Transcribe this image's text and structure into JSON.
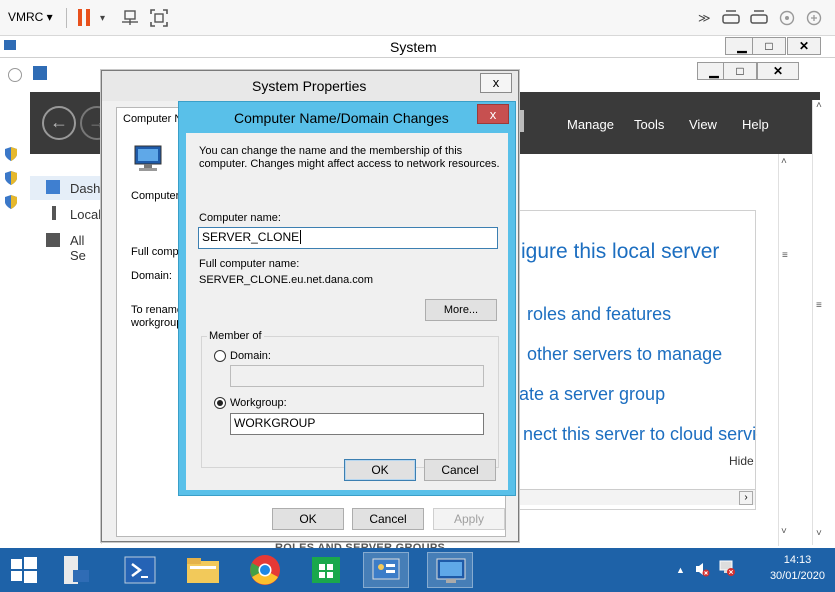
{
  "vmrc": {
    "label": "VMRC"
  },
  "system_window": {
    "title": "System",
    "btn_min": "▁",
    "btn_max": "□",
    "btn_close": "✕"
  },
  "server_manager": {
    "menus": [
      "Manage",
      "Tools",
      "View",
      "Help"
    ],
    "nav": [
      "Dash",
      "Local",
      "All Se"
    ],
    "welcome": [
      "igure this local server",
      "roles and features",
      "other servers to manage",
      "ate a server group",
      "nect this server to cloud servic"
    ],
    "hide": "Hide",
    "bottom_text": "ROLES AND SERVER GROUPS"
  },
  "system_properties": {
    "title": "System Properties",
    "close": "x",
    "tab_partial": "Computer N",
    "computer_partial": "Computer d",
    "full_computer_partial": "Full compu",
    "domain_partial": "Domain:",
    "rename_partial_1": "To rename",
    "rename_partial_2": "workgroup",
    "ok": "OK",
    "cancel": "Cancel",
    "apply": "Apply"
  },
  "computer_name_dialog": {
    "title": "Computer Name/Domain Changes",
    "close": "x",
    "intro_line1": "You can change the name and the membership of this",
    "intro_line2": "computer. Changes might affect access to network resources.",
    "computer_name_label": "Computer name:",
    "computer_name_value": "SERVER_CLONE",
    "full_name_label": "Full computer name:",
    "full_name_value": "SERVER_CLONE.eu.net.dana.com",
    "more": "More...",
    "member_of": "Member of",
    "domain_label": "Domain:",
    "domain_value": "",
    "workgroup_label": "Workgroup:",
    "workgroup_value": "WORKGROUP",
    "selected_membership": "Workgroup",
    "ok": "OK",
    "cancel": "Cancel"
  },
  "taskbar": {
    "time": "14:13",
    "date": "30/01/2020"
  },
  "colors": {
    "dialog_frame": "#59c0e9",
    "taskbar": "#1e62a8",
    "server_manager_header": "#3a3a3a",
    "link_blue": "#1c6ec0",
    "close_red": "#c75050",
    "pause_orange": "#e8501c"
  }
}
